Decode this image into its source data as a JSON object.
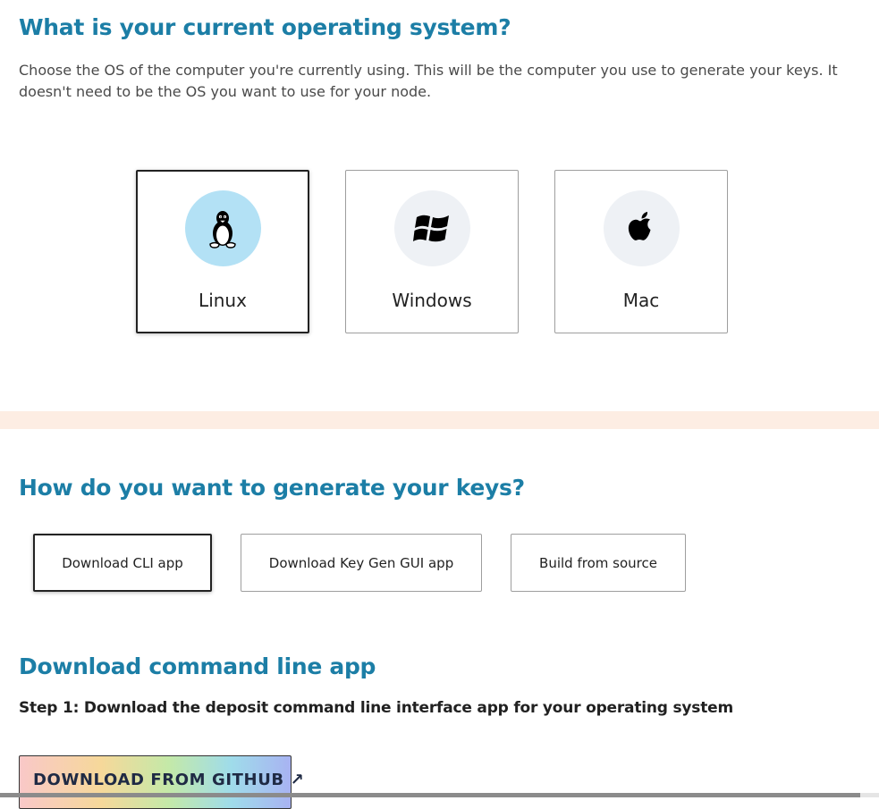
{
  "os_section": {
    "title": "What is your current operating system?",
    "description": "Choose the OS of the computer you're currently using. This will be the computer you use to generate your keys. It doesn't need to be the OS you want to use for your node.",
    "options": [
      {
        "label": "Linux",
        "icon": "linux-penguin-icon",
        "selected": true
      },
      {
        "label": "Windows",
        "icon": "windows-logo-icon",
        "selected": false
      },
      {
        "label": "Mac",
        "icon": "apple-logo-icon",
        "selected": false
      }
    ]
  },
  "method_section": {
    "title": "How do you want to generate your keys?",
    "options": [
      {
        "label": "Download CLI app",
        "selected": true
      },
      {
        "label": "Download Key Gen GUI app",
        "selected": false
      },
      {
        "label": "Build from source",
        "selected": false
      }
    ]
  },
  "cli_section": {
    "title": "Download command line app",
    "step1": "Step 1: Download the deposit command line interface app for your operating system",
    "download_button": "DOWNLOAD FROM GITHUB ↗"
  },
  "colors": {
    "heading": "#1c7ea6",
    "selected_icon_bg": "#b3e1f5",
    "icon_bg": "#eef1f5",
    "band": "#fdede3"
  }
}
